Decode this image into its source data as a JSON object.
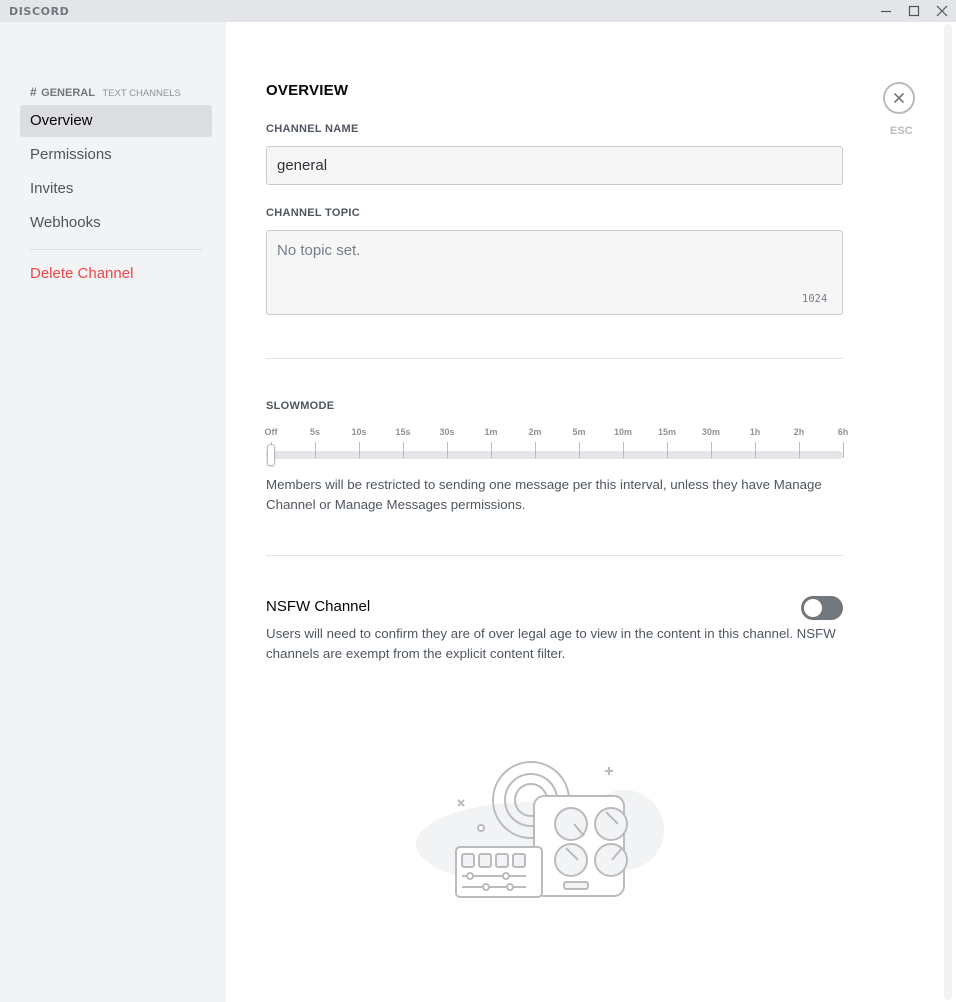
{
  "app": {
    "logo_text": "DISCORD"
  },
  "window_controls": {
    "minimize_icon": "minimize-icon",
    "maximize_icon": "maximize-icon",
    "close_icon": "close-icon"
  },
  "sidebar": {
    "header": {
      "hash": "#",
      "channel": "GENERAL",
      "category": "TEXT CHANNELS"
    },
    "items": [
      {
        "label": "Overview",
        "active": true
      },
      {
        "label": "Permissions"
      },
      {
        "label": "Invites"
      },
      {
        "label": "Webhooks"
      }
    ],
    "delete_label": "Delete Channel"
  },
  "main": {
    "title": "OVERVIEW",
    "channel_name": {
      "label": "CHANNEL NAME",
      "value": "general"
    },
    "channel_topic": {
      "label": "CHANNEL TOPIC",
      "placeholder": "No topic set.",
      "value": "",
      "counter": "1024"
    },
    "slowmode": {
      "label": "SLOWMODE",
      "ticks": [
        "Off",
        "5s",
        "10s",
        "15s",
        "30s",
        "1m",
        "2m",
        "5m",
        "10m",
        "15m",
        "30m",
        "1h",
        "2h",
        "6h"
      ],
      "selected": "Off",
      "description": "Members will be restricted to sending one message per this interval, unless they have Manage Channel or Manage Messages permissions."
    },
    "nsfw": {
      "title": "NSFW Channel",
      "enabled": false,
      "description": "Users will need to confirm they are of over legal age to view in the content in this channel. NSFW channels are exempt from the explicit content filter."
    },
    "close": {
      "icon": "close-icon",
      "label": "ESC"
    }
  },
  "colors": {
    "danger": "#f04747",
    "toggle_off": "#72767d",
    "sidebar_bg": "#f2f3f5",
    "titlebar_bg": "#e3e5e8"
  }
}
